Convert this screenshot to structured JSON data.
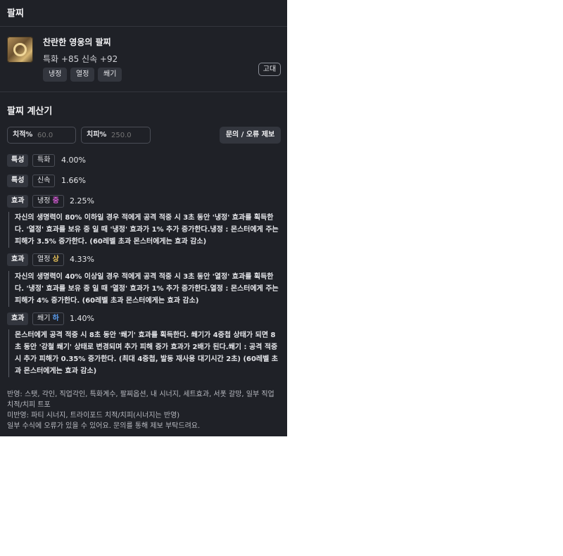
{
  "header": {
    "title": "팔찌"
  },
  "item": {
    "name": "찬란한 영웅의 팔찌",
    "stats": "특화 +85  신속 +92",
    "grade": "고대",
    "icon": "bracelet-icon",
    "tags": [
      "냉정",
      "열정",
      "쐐기"
    ]
  },
  "calculator": {
    "title": "팔찌 계산기",
    "crit_rate": {
      "label": "치적%",
      "placeholder": "60.0"
    },
    "crit_dmg": {
      "label": "치피%",
      "placeholder": "250.0"
    },
    "report_label": "문의 / 오류 제보",
    "rows": [
      {
        "kind": "특성",
        "name": "특화",
        "level": "",
        "value": "4.00%"
      },
      {
        "kind": "특성",
        "name": "신속",
        "level": "",
        "value": "1.66%"
      },
      {
        "kind": "효과",
        "name": "냉정",
        "level": "중",
        "value": "2.25%",
        "desc": "자신의 생명력이 80% 이하일 경우 적에게 공격 적중 시 3초 동안 '냉정' 효과를 획득한다. '열정' 효과를 보유 중 일 때 '냉정' 효과가 1% 추가 증가한다.냉정 : 몬스터에게 주는 피해가 3.5% 증가한다. (60레벨 초과 몬스터에게는 효과 감소)"
      },
      {
        "kind": "효과",
        "name": "열정",
        "level": "상",
        "value": "4.33%",
        "desc": "자신의 생명력이 40% 이상일 경우 적에게 공격 적중 시 3초 동안 '열정' 효과를 획득한다. '냉정' 효과를 보유 중 일 때 '열정' 효과가 1% 추가 증가한다.열정 : 몬스터에게 주는 피해가 4% 증가한다. (60레벨 초과 몬스터에게는 효과 감소)"
      },
      {
        "kind": "효과",
        "name": "쐐기",
        "level": "하",
        "value": "1.40%",
        "desc": "몬스터에게 공격 적중 시 8초 동안 '쐐기' 효과를 획득한다. 쐐기가 4중첩 상태가 되면 8초 동안 '강철 쐐기' 상태로 변경되며 추가 피해 증가 효과가 2배가 된다.쐐기 : 공격 적중 시 추가 피해가 0.35% 증가한다. (최대 4중첩, 발동 재사용 대기시간 2초) (60레벨 초과 몬스터에게는 효과 감소)"
      }
    ]
  },
  "footer": {
    "line1": "반영: 스탯, 각인, 직업각인, 특화계수, 팔찌옵션, 내 시너지, 세트효과, 서폿 갈망, 일부 직업 치적/치피 트포",
    "line2": "미반영: 파티 시너지, 트라이포드 치적/치피(시너지는 반영)",
    "line3": "일부 수식에 오류가 있을 수 있어요. 문의를 통해 제보 부탁드려요."
  }
}
